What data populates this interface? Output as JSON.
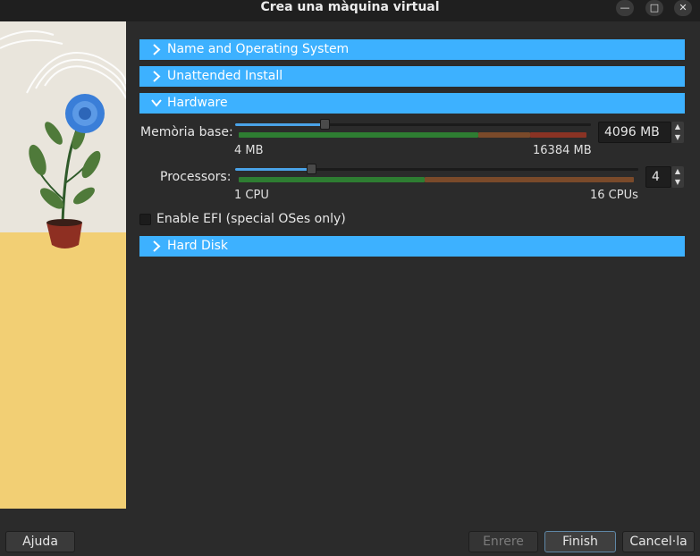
{
  "window": {
    "title": "Crea una màquina virtual",
    "controls": {
      "minimize": "—",
      "maximize": "□",
      "close": "✕"
    }
  },
  "sections": {
    "name_os": {
      "label": "Name and Operating System",
      "expanded": false
    },
    "unattended": {
      "label": "Unattended Install",
      "expanded": false
    },
    "hardware": {
      "label": "Hardware",
      "expanded": true
    },
    "hard_disk": {
      "label": "Hard Disk",
      "expanded": false
    }
  },
  "hardware": {
    "memory": {
      "label": "Memòria base:",
      "value": "4096 MB",
      "min_label": "4 MB",
      "max_label": "16384 MB",
      "level": 0.25
    },
    "processors": {
      "label": "Processors:",
      "value": "4",
      "min_label": "1 CPU",
      "max_label": "16 CPUs",
      "level": 0.1875
    },
    "efi": {
      "label": "Enable EFI (special OSes only)",
      "checked": false
    }
  },
  "buttons": {
    "help": "Ajuda",
    "back": "Enrere",
    "finish": "Finish",
    "cancel": "Cancel·la"
  },
  "colors": {
    "section_header": "#3db1ff",
    "slider_fill": "#4aa3e8",
    "scale_green": "#2e7d32",
    "scale_red": "#8a3324",
    "scale_orange": "#7a4a2a"
  },
  "icons": {
    "collapsed": "chevron-right-icon",
    "expanded": "chevron-down-icon",
    "spin_up": "▲",
    "spin_down": "▼"
  }
}
